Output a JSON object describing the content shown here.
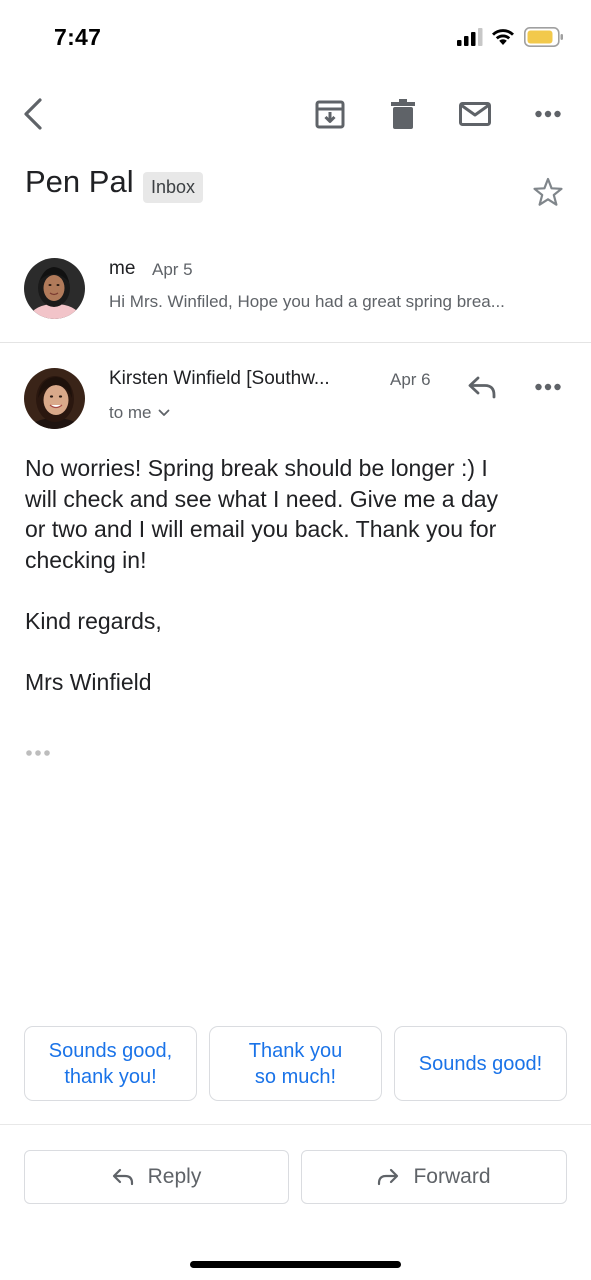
{
  "status_bar": {
    "time": "7:47",
    "battery_color": "#f2c94c"
  },
  "toolbar": {
    "icons": [
      "back-arrow-icon",
      "archive-icon",
      "trash-icon",
      "mail-icon",
      "more-horizontal-icon"
    ]
  },
  "thread": {
    "subject": "Pen Pal",
    "label": "Inbox",
    "starred": false
  },
  "messages": [
    {
      "sender": "me",
      "date": "Apr 5",
      "snippet": "Hi Mrs. Winfiled, Hope you had a great spring brea..."
    },
    {
      "sender": "Kirsten Winfield [Southw...",
      "date": "Apr 6",
      "recipient": "to me",
      "body": {
        "paragraph1_lines": [
          "No worries! Spring break should be longer :) I",
          "will check and see what I need. Give me a day",
          "or two and I will email you back. Thank you for",
          "checking in!"
        ],
        "closing": "Kind regards,",
        "signature": "Mrs Winfield"
      }
    }
  ],
  "smart_replies": [
    {
      "line1": "Sounds good,",
      "line2": "thank you!"
    },
    {
      "line1": "Thank you",
      "line2": "so much!"
    },
    {
      "line1": "Sounds good!",
      "line2": ""
    }
  ],
  "actions": {
    "reply_label": "Reply",
    "forward_label": "Forward"
  },
  "colors": {
    "accent_blue": "#1a73e8",
    "muted_text": "#5f6368",
    "badge_bg": "#e8e8e8"
  }
}
